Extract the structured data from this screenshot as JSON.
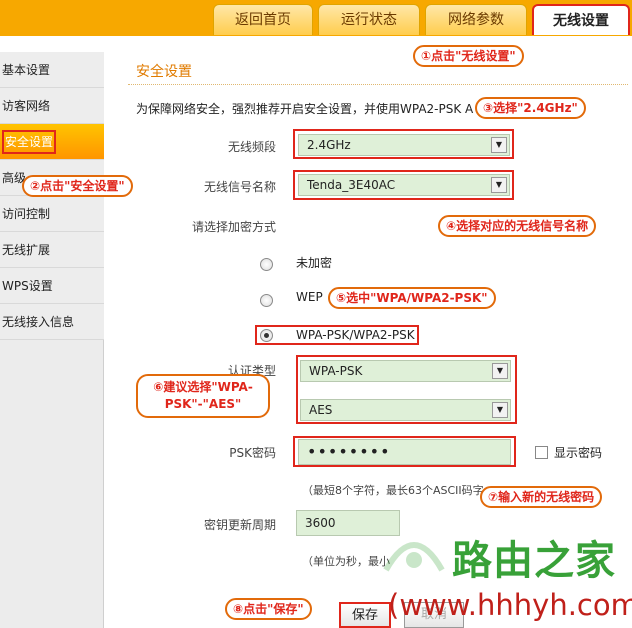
{
  "tabs": [
    {
      "label": "返回首页"
    },
    {
      "label": "运行状态"
    },
    {
      "label": "网络参数"
    },
    {
      "label": "无线设置",
      "active": true
    }
  ],
  "sidebar": {
    "items": [
      {
        "label": "基本设置"
      },
      {
        "label": "访客网络"
      },
      {
        "label": "安全设置",
        "active": true
      },
      {
        "label": "高级"
      },
      {
        "label": "访问控制"
      },
      {
        "label": "无线扩展"
      },
      {
        "label": "WPS设置"
      },
      {
        "label": "无线接入信息"
      }
    ]
  },
  "main": {
    "section_title": "安全设置",
    "description": "为保障网络安全，强烈推荐开启安全设置，并使用WPA2-PSK A",
    "band_label": "无线频段",
    "band_value": "2.4GHz",
    "ssid_label": "无线信号名称",
    "ssid_value": "Tenda_3E40AC",
    "encrypt_label": "请选择加密方式",
    "options": [
      "未加密",
      "WEP",
      "WPA-PSK/WPA2-PSK"
    ],
    "selected_option": "WPA-PSK/WPA2-PSK",
    "auth_label": "认证类型",
    "auth_value": "WPA-PSK",
    "cipher_value": "AES",
    "psk_label": "PSK密码",
    "psk_value": "••••••••",
    "show_password_label": "显示密码",
    "psk_hint": "（最短8个字符，最长63个ASCII码字",
    "rekey_label": "密钥更新周期",
    "rekey_value": "3600",
    "rekey_hint": "（单位为秒，最小",
    "save_label": "保存",
    "cancel_label": "取消"
  },
  "callouts": {
    "c1": "①点击\"无线设置\"",
    "c2": "②点击\"安全设置\"",
    "c3": "③选择\"2.4GHz\"",
    "c4": "④选择对应的无线信号名称",
    "c5": "⑤选中\"WPA/WPA2-PSK\"",
    "c6_line1": "⑥建议选择\"WPA-",
    "c6_line2": "PSK\"-\"AES\"",
    "c7": "⑦输入新的无线密码",
    "c8": "⑧点击\"保存\""
  },
  "watermark": {
    "brand": "路由之家",
    "url": "(www.hhhyh.com)"
  },
  "colors": {
    "accent_orange": "#f7a800",
    "highlight_red": "#e0261b",
    "field_green": "#dff0d8",
    "watermark_green": "#2e9d2e"
  }
}
